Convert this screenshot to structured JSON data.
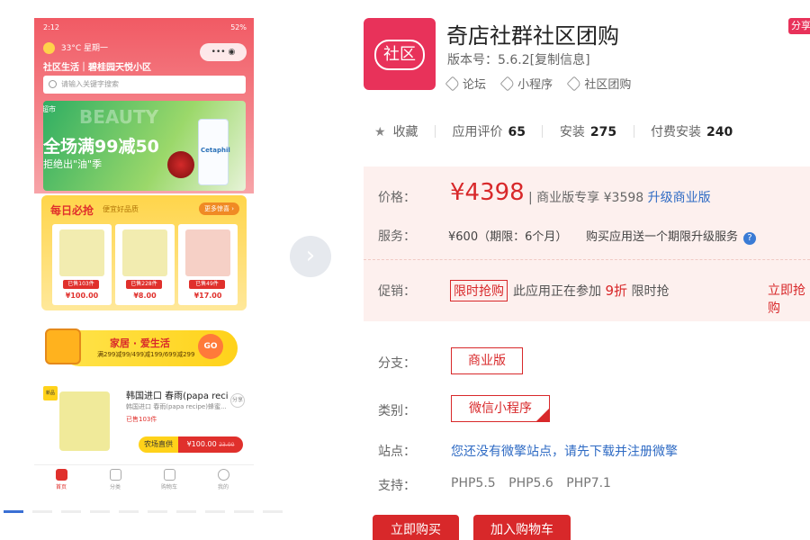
{
  "phone": {
    "status_time": "2:12",
    "status_right": "52%",
    "weather": "33°C 星期一",
    "community": "社区生活｜碧桂园天悦小区",
    "capsule": "•••  ◉",
    "search_placeholder": "请输入关键字搜索",
    "banner": {
      "tag": "超市",
      "watermark": "BEAUTY",
      "headline": "全场满99减50",
      "subline": "拒绝出\"油\"季",
      "product_label": "Cetaphil"
    },
    "daily": {
      "title": "每日必抢",
      "subtitle": "便宜好品质",
      "more": "更多惊喜 ›",
      "items": [
        {
          "sold": "已售103件",
          "price": "¥100.00"
        },
        {
          "sold": "已售228件",
          "price": "¥8.00"
        },
        {
          "sold": "已售49件",
          "price": "¥17.00"
        }
      ]
    },
    "home_banner": {
      "title": "家居 · 爱生活",
      "subtitle": "满299减99/499减199/699减299",
      "go": "GO"
    },
    "product": {
      "flag": "新品",
      "name": "韩国进口 春雨(papa reci",
      "desc": "韩国进口 春雨(papa recipe)蜂蜜...",
      "sold": "已售103件",
      "share": "分享",
      "tag": "农场直供",
      "price": "¥100.00",
      "old_price": "23.00"
    },
    "tabs": [
      "首页",
      "分类",
      "购物车",
      "我的"
    ]
  },
  "app": {
    "icon_text": "社区",
    "title": "奇店社群社区团购",
    "version": "版本号：5.6.2[复制信息]",
    "tags": [
      "论坛",
      "小程序",
      "社区团购"
    ],
    "share": "分享"
  },
  "stats": {
    "favorite": "收藏",
    "rating_label": "应用评价",
    "rating": "65",
    "install_label": "安装",
    "install": "275",
    "paid_label": "付费安装",
    "paid": "240"
  },
  "pricing": {
    "price_label": "价格：",
    "price": "¥4398",
    "pro_label": "商业版专享",
    "pro_price": "¥3598",
    "upgrade": "升级商业版",
    "service_label": "服务：",
    "service_text": "¥600（期限：6个月）     购买应用送一个期限升级服务",
    "promo_label": "促销：",
    "promo_badge": "限时抢购",
    "promo_text": "此应用正在参加",
    "promo_discount": "9折",
    "promo_suffix": "限时抢",
    "promo_link": "立即抢购"
  },
  "options": {
    "branch_label": "分支：",
    "branch": "商业版",
    "category_label": "类别：",
    "category": "微信小程序",
    "station_label": "站点：",
    "station": "您还没有微擎站点，请先下载并注册微擎",
    "support_label": "支持：",
    "support": [
      "PHP5.5",
      "PHP5.6",
      "PHP7.1"
    ]
  },
  "actions": {
    "buy": "立即购买",
    "cart": "加入购物车"
  },
  "colors": {
    "accent": "#d8282a",
    "link": "#2f6bc4",
    "price_panel_bg": "#fdf0ee"
  }
}
